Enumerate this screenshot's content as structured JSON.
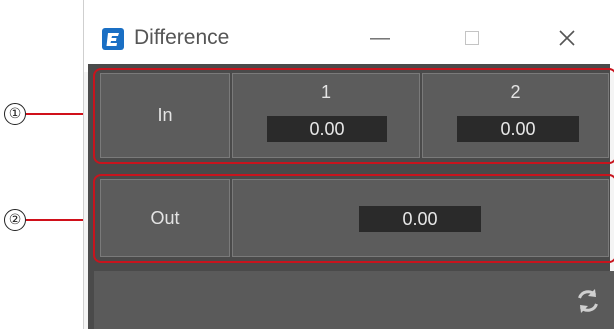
{
  "callouts": {
    "one": "①",
    "two": "②"
  },
  "window": {
    "title": "Difference",
    "logo_letter": "E",
    "controls": {
      "minimize": "—",
      "maximize": "☐",
      "close": "✕"
    }
  },
  "in_section": {
    "label": "In",
    "channels": [
      {
        "number": "1",
        "value": "0.00"
      },
      {
        "number": "2",
        "value": "0.00"
      }
    ]
  },
  "out_section": {
    "label": "Out",
    "value": "0.00"
  },
  "footer": {
    "refresh_icon": "refresh-icon"
  },
  "colors": {
    "highlight": "#c8141d",
    "panel": "#5c5c5c",
    "value_bg": "#2a2a2a",
    "logo": "#1a6fc4"
  }
}
